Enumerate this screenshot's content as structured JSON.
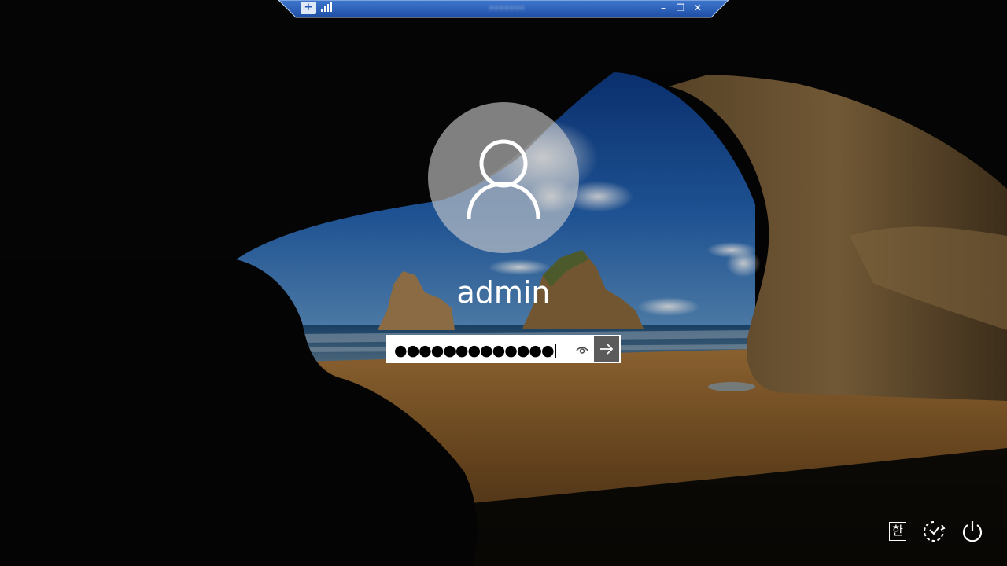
{
  "remote_bar": {
    "title": "•••••••",
    "minimize_label": "–",
    "restore_label": "❐",
    "close_label": "✕",
    "pin_label": "+",
    "icons": [
      "pin-icon",
      "signal-icon",
      "minimize-icon",
      "restore-icon",
      "close-icon"
    ]
  },
  "login": {
    "username": "admin",
    "password_mask": "●●●●●●●●●●●●●",
    "icons": [
      "user-avatar-icon",
      "reveal-password-icon",
      "submit-arrow-icon"
    ]
  },
  "tray": {
    "ime_label": "한",
    "icons": [
      "ime-icon",
      "ease-of-access-icon",
      "power-icon"
    ]
  },
  "colors": {
    "rdp_bar": "#2a5db5",
    "submit_button": "#5b5b5b",
    "text": "#ffffff"
  }
}
